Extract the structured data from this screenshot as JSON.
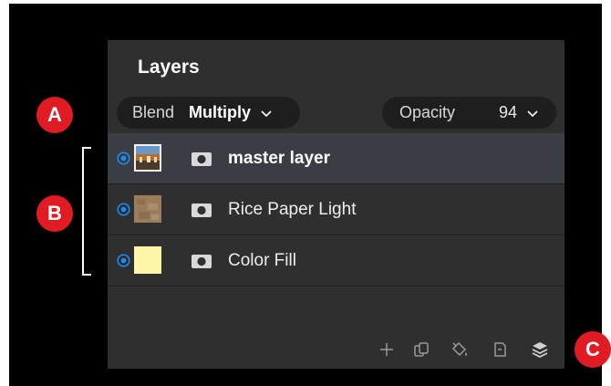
{
  "panel": {
    "title": "Layers"
  },
  "blend": {
    "label": "Blend",
    "value": "Multiply",
    "icon": "chevron-down-icon"
  },
  "opacity": {
    "label": "Opacity",
    "value": "94",
    "icon": "chevron-down-icon"
  },
  "layers": [
    {
      "label": "master layer",
      "selected": true,
      "visible": true,
      "thumb": "photo"
    },
    {
      "label": "Rice Paper Light",
      "selected": false,
      "visible": true,
      "thumb": "paper-texture"
    },
    {
      "label": "Color Fill",
      "selected": false,
      "visible": true,
      "thumb": "solid-color",
      "fill_color": "#fff6a8"
    }
  ],
  "toolbar": {
    "icons": [
      "add-icon",
      "duplicate-icon",
      "fill-bucket-icon",
      "new-layer-icon",
      "layers-stack-icon"
    ]
  },
  "callouts": {
    "a": "A",
    "b": "B",
    "c": "C"
  },
  "colors": {
    "accent": "#1a8cff",
    "callout": "#e01b23",
    "panel_bg": "#2f2f2f",
    "selected_row": "#3a3d44"
  }
}
